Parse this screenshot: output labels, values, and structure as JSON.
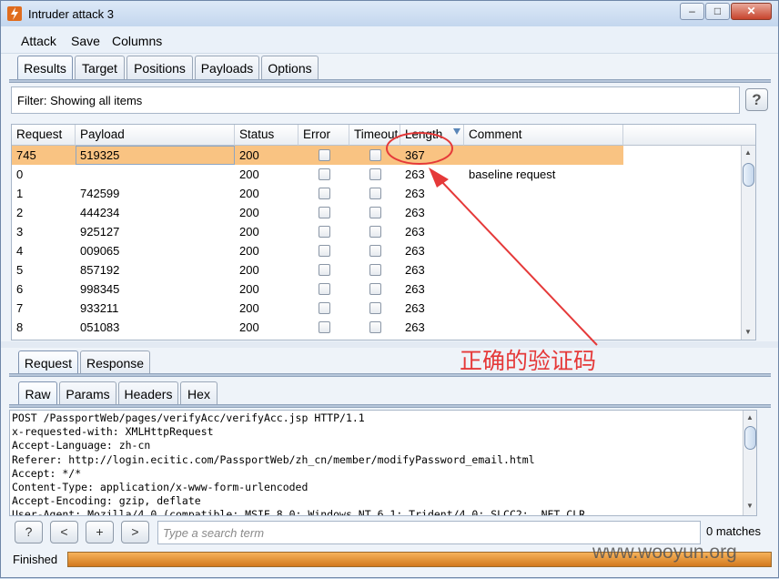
{
  "window": {
    "title": "Intruder attack 3",
    "min_glyph": "–",
    "max_glyph": "□",
    "close_glyph": "✕"
  },
  "menu": [
    "Attack",
    "Save",
    "Columns"
  ],
  "main_tabs": [
    {
      "label": "Results",
      "active": true
    },
    {
      "label": "Target"
    },
    {
      "label": "Positions"
    },
    {
      "label": "Payloads"
    },
    {
      "label": "Options"
    }
  ],
  "filter": {
    "text": "Filter: Showing all items",
    "help": "?"
  },
  "table": {
    "columns": [
      "Request",
      "Payload",
      "Status",
      "Error",
      "Timeout",
      "Length",
      "Comment"
    ],
    "sorted_column": "Length",
    "rows": [
      {
        "request": "745",
        "payload": "519325",
        "status": "200",
        "length": "367",
        "comment": "",
        "selected": true
      },
      {
        "request": "0",
        "payload": "",
        "status": "200",
        "length": "263",
        "comment": "baseline request"
      },
      {
        "request": "1",
        "payload": "742599",
        "status": "200",
        "length": "263",
        "comment": ""
      },
      {
        "request": "2",
        "payload": "444234",
        "status": "200",
        "length": "263",
        "comment": ""
      },
      {
        "request": "3",
        "payload": "925127",
        "status": "200",
        "length": "263",
        "comment": ""
      },
      {
        "request": "4",
        "payload": "009065",
        "status": "200",
        "length": "263",
        "comment": ""
      },
      {
        "request": "5",
        "payload": "857192",
        "status": "200",
        "length": "263",
        "comment": ""
      },
      {
        "request": "6",
        "payload": "998345",
        "status": "200",
        "length": "263",
        "comment": ""
      },
      {
        "request": "7",
        "payload": "933211",
        "status": "200",
        "length": "263",
        "comment": ""
      },
      {
        "request": "8",
        "payload": "051083",
        "status": "200",
        "length": "263",
        "comment": ""
      }
    ]
  },
  "detail_tabs": [
    {
      "label": "Request",
      "active": true
    },
    {
      "label": "Response"
    }
  ],
  "view_tabs": [
    {
      "label": "Raw",
      "active": true
    },
    {
      "label": "Params"
    },
    {
      "label": "Headers"
    },
    {
      "label": "Hex"
    }
  ],
  "request_lines": [
    "POST /PassportWeb/pages/verifyAcc/verifyAcc.jsp HTTP/1.1",
    "x-requested-with: XMLHttpRequest",
    "Accept-Language: zh-cn",
    "Referer: http://login.ecitic.com/PassportWeb/zh_cn/member/modifyPassword_email.html",
    "Accept: */*",
    "Content-Type: application/x-www-form-urlencoded",
    "Accept-Encoding: gzip, deflate",
    "User-Agent: Mozilla/4.0 (compatible; MSIE 8.0; Windows NT 6.1; Trident/4.0; SLCC2; .NET CLR"
  ],
  "search": {
    "help": "?",
    "prev": "<",
    "add": "+",
    "next": ">",
    "placeholder": "Type a search term",
    "matches": "0 matches"
  },
  "status": {
    "text": "Finished",
    "progress": 1.0
  },
  "annotation": {
    "text": "正确的验证码",
    "color": "#e53939"
  },
  "watermark": "www.wooyun.org",
  "colors": {
    "selected_row": "#f9c382",
    "progress": "#e0862a",
    "accent_tab": "#b6c6da"
  },
  "icons": [
    "burp-app-icon",
    "minimize-icon",
    "maximize-icon",
    "close-icon",
    "help-icon",
    "sort-desc-icon"
  ]
}
